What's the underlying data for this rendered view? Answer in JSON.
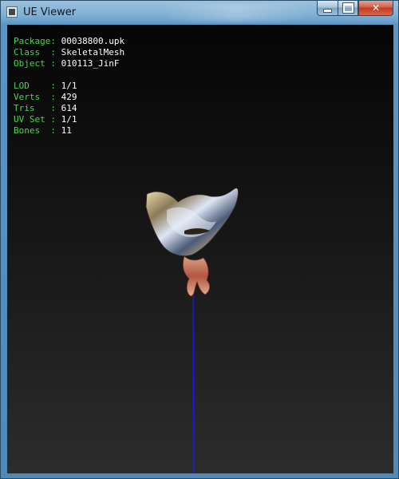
{
  "window": {
    "title": "UE Viewer",
    "icon": "app-icon",
    "buttons": {
      "minimize": "minimize-icon",
      "maximize": "maximize-icon",
      "close": "close-icon"
    },
    "close_glyph": "✕"
  },
  "info": {
    "package": {
      "label": "Package: ",
      "value": "00038800.upk"
    },
    "class": {
      "label": "Class  : ",
      "value": "SkeletalMesh"
    },
    "object": {
      "label": "Object : ",
      "value": "010113_JinF"
    },
    "lod": {
      "label": "LOD    : ",
      "value": "1/1"
    },
    "verts": {
      "label": "Verts  : ",
      "value": "429"
    },
    "tris": {
      "label": "Tris   : ",
      "value": "614"
    },
    "uvset": {
      "label": "UV Set : ",
      "value": "1/1"
    },
    "bones": {
      "label": "Bones  : ",
      "value": "11"
    }
  },
  "colors": {
    "label_green": "#48d948",
    "value_white": "#ffffff",
    "bone_line": "#1a1aff",
    "close_red": "#c23a20"
  }
}
